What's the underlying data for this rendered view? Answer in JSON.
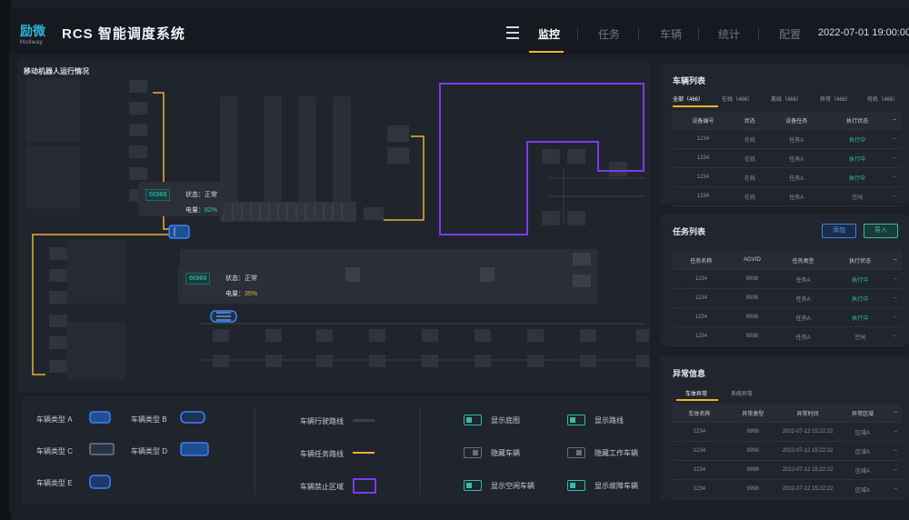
{
  "header": {
    "logo_text": "励微",
    "logo_sub": "Mollway",
    "title": "RCS 智能调度系统",
    "nav": [
      "监控",
      "任务",
      "车辆",
      "统计",
      "配置"
    ],
    "active_nav": "监控",
    "datetime": "2022-07-01 19:00:00"
  },
  "map": {
    "title": "移动机器人运行情况",
    "tooltips": [
      {
        "id": "66988",
        "status_label": "状态：正常",
        "battery_label": "电量：",
        "battery": "82%"
      },
      {
        "id": "66988",
        "status_label": "状态：正常",
        "battery_label": "电量：",
        "battery": "35%"
      }
    ],
    "colors": {
      "route": "#e8b12e",
      "forbidden": "#7c3aed",
      "vehicle": "#3b82f6"
    }
  },
  "legend": {
    "vehicle_types": [
      "车辆类型 A",
      "车辆类型 B",
      "车辆类型 C",
      "车辆类型 D",
      "车辆类型 E"
    ],
    "routes": [
      "车辆行驶路线",
      "车辆任务路线",
      "车辆禁止区域"
    ],
    "toggles": [
      {
        "label": "显示底图",
        "on": true
      },
      {
        "label": "显示路线",
        "on": true
      },
      {
        "label": "隐藏车辆",
        "on": false
      },
      {
        "label": "隐藏工作车辆",
        "on": false
      },
      {
        "label": "显示空闲车辆",
        "on": true
      },
      {
        "label": "显示故障车辆",
        "on": true
      }
    ]
  },
  "vehicle_list": {
    "title": "车辆列表",
    "tabs": [
      "全部（466）",
      "在线（466）",
      "离线（466）",
      "异常（466）",
      "待机（466）"
    ],
    "columns": [
      "设备编号",
      "状态",
      "设备任务",
      "执行状态",
      "--"
    ],
    "rows": [
      [
        "1234",
        "在线",
        "任务A",
        "执行中",
        "--"
      ],
      [
        "1234",
        "在线",
        "任务A",
        "执行中",
        "--"
      ],
      [
        "1234",
        "在线",
        "任务A",
        "执行中",
        "--"
      ],
      [
        "1234",
        "在线",
        "任务A",
        "空闲",
        "--"
      ]
    ]
  },
  "task_list": {
    "title": "任务列表",
    "add_label": "添加",
    "import_label": "导入",
    "columns": [
      "任务名称",
      "AGVID",
      "任务类型",
      "执行状态",
      "--"
    ],
    "rows": [
      [
        "1234",
        "9998",
        "任务A",
        "执行中",
        "--"
      ],
      [
        "1234",
        "9998",
        "任务A",
        "执行中",
        "--"
      ],
      [
        "1234",
        "9998",
        "任务A",
        "执行中",
        "--"
      ],
      [
        "1234",
        "9998",
        "任务A",
        "空闲",
        "--"
      ]
    ]
  },
  "alerts": {
    "title": "异常信息",
    "tabs": [
      "车体异常",
      "系统异常"
    ],
    "columns": [
      "车体名称",
      "异常类型",
      "异常时间",
      "异常区域",
      "--"
    ],
    "rows": [
      [
        "1234",
        "9998",
        "2022-07-12 15:22:22",
        "区域A",
        "--"
      ],
      [
        "1234",
        "9998",
        "2022-07-12 15:22:22",
        "区域A",
        "--"
      ],
      [
        "1234",
        "9998",
        "2022-07-12 15:22:22",
        "区域A",
        "--"
      ],
      [
        "1234",
        "9998",
        "2022-07-12 15:22:22",
        "区域A",
        "--"
      ]
    ]
  }
}
